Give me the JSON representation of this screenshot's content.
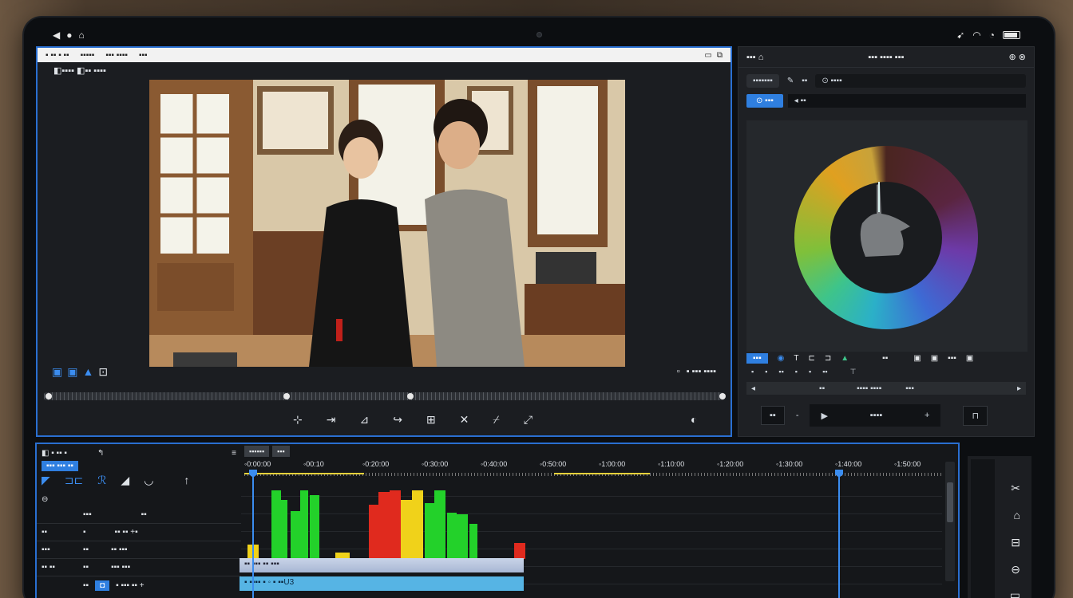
{
  "status": {
    "left_icons": [
      "back-icon",
      "record-icon",
      "home-icon"
    ],
    "right_icons": [
      "signal-icon",
      "wifi-icon",
      "cast-icon",
      "battery-icon"
    ]
  },
  "viewer": {
    "titlebar_items": [
      "▪ ▪▪ ▪ ▪▪",
      "▪▪▪▪▪",
      "▪▪▪ ▪▪▪▪",
      "▪▪▪"
    ],
    "label": "◧▪▪▪▪ ◧▪▪ ▪▪▪▪",
    "tools_left": [
      "▣",
      "▣",
      "▲",
      "⊡"
    ],
    "tools_right": "▪ ▪▪▪ ▪▪▪▪",
    "bottom_tools": [
      "⊹",
      "⇥",
      "⊿",
      "↪",
      "⊞",
      "✕",
      "⌿",
      "⤢"
    ],
    "end_tool": "◐"
  },
  "right": {
    "header_left": "▪▪▪ ⌂",
    "header_center": "▪▪▪ ▪▪▪▪ ▪▪▪",
    "header_right": "⊕ ⊗",
    "tab1": "▪▪▪▪▪▪▪",
    "tab2": "▪▪",
    "tab3": "⊙ ▪▪▪▪",
    "blue_btn": "⊙ ▪▪▪",
    "field": "◂ ▪▪",
    "icon_row_sel": "▪▪▪",
    "icon_row": [
      "◉",
      "T",
      "⊏",
      "⊐",
      "▲",
      "▪▪",
      "▣",
      "▣",
      "▪▪▪",
      "▣"
    ],
    "icon_row2": [
      "▪",
      "▪",
      "▪▪",
      "▪",
      "▪",
      "▪▪",
      "⊤"
    ],
    "nav": [
      "◂",
      "▪▪",
      "▪▪▪▪ ▪▪▪▪",
      "▪▪▪",
      "▸"
    ],
    "box": "▪▪",
    "dash": "-",
    "play_label": "▪▪▪▪",
    "plus": "+"
  },
  "timeline": {
    "header": "◧ ▪ ▪▪ ▪",
    "header_btn": "▪▪▪ ▪▪▪ ▪▪",
    "tabs": [
      "▪▪▪▪▪▪",
      "▪▪▪"
    ],
    "ticks": [
      "0:00:00",
      "00:10",
      "0:20:00",
      "0:30:00",
      "0:40:00",
      "0:50:00",
      "1:00:00",
      "1:10:00",
      "1:20:00",
      "1:30:00",
      "1:40:00",
      "1:50:00"
    ],
    "rows": [
      [
        "",
        "▪▪▪",
        "▪▪"
      ],
      [
        "▪▪",
        "▪",
        "▪▪ ▪▪ +▪"
      ],
      [
        "▪▪▪",
        "▪▪",
        "▪▪ ▪▪▪"
      ],
      [
        "▪▪ ▪▪",
        "▪▪",
        "▪▪▪ ▪▪▪"
      ],
      [
        "",
        "▪▪",
        "▪ ▪▪▪ ▪▪ +"
      ]
    ],
    "clip_a": "▪▪ ▪▪▪ ▪▪ ▪▪▪",
    "clip_b": "▪ ▪▪▪▪ ▪ ◦ ▪ ▪▪U3"
  },
  "chart_data": {
    "type": "bar",
    "colors": {
      "green": "#23d12a",
      "red": "#e02a1e",
      "yellow": "#f0d21a"
    }
  },
  "colors": {
    "accent": "#2f7fe0",
    "panel": "#1e2024"
  }
}
